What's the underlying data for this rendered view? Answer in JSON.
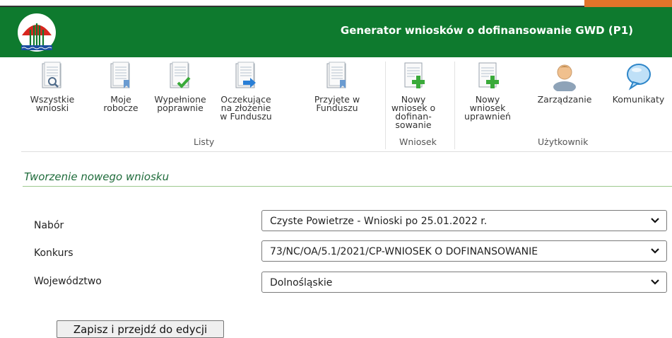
{
  "header": {
    "title": "Generator wniosków o dofinansowanie GWD (P1)"
  },
  "ribbon": {
    "buttons": [
      {
        "label": "Wszystkie\nwnioski",
        "icon": "search-document-icon"
      },
      {
        "label": "Moje\nrobocze",
        "icon": "document-icon"
      },
      {
        "label": "Wypełnione\npoprawnie",
        "icon": "document-check-icon"
      },
      {
        "label": "Oczekujące\nna złożenie\nw Funduszu",
        "icon": "document-arrow-icon"
      },
      {
        "label": "Przyjęte w\nFunduszu",
        "icon": "document-icon"
      },
      {
        "label": "Nowy\nwniosek o\ndofinan-\nsowanie",
        "icon": "new-document-plus-icon"
      },
      {
        "label": "Nowy\nwniosek\nuprawnień",
        "icon": "new-document-plus-icon"
      },
      {
        "label": "Zarządzanie",
        "icon": "user-icon"
      },
      {
        "label": "Komunikaty",
        "icon": "speech-bubble-icon"
      }
    ],
    "groups": [
      "Listy",
      "Wniosek",
      "Użytkownik"
    ]
  },
  "form": {
    "title": "Tworzenie nowego wniosku",
    "fields": [
      {
        "label": "Nabór",
        "value": "Czyste Powietrze - Wnioski po 25.01.2022 r."
      },
      {
        "label": "Konkurs",
        "value": "73/NC/OA/5.1/2021/CP-WNIOSEK O DOFINANSOWANIE"
      },
      {
        "label": "Województwo",
        "value": "Dolnośląskie"
      }
    ],
    "submit_label": "Zapisz i przejdź do edycji"
  },
  "colors": {
    "header_bg": "#0e7a2e",
    "accent_orange": "#e0742a",
    "section_title": "#1f6c3b"
  }
}
